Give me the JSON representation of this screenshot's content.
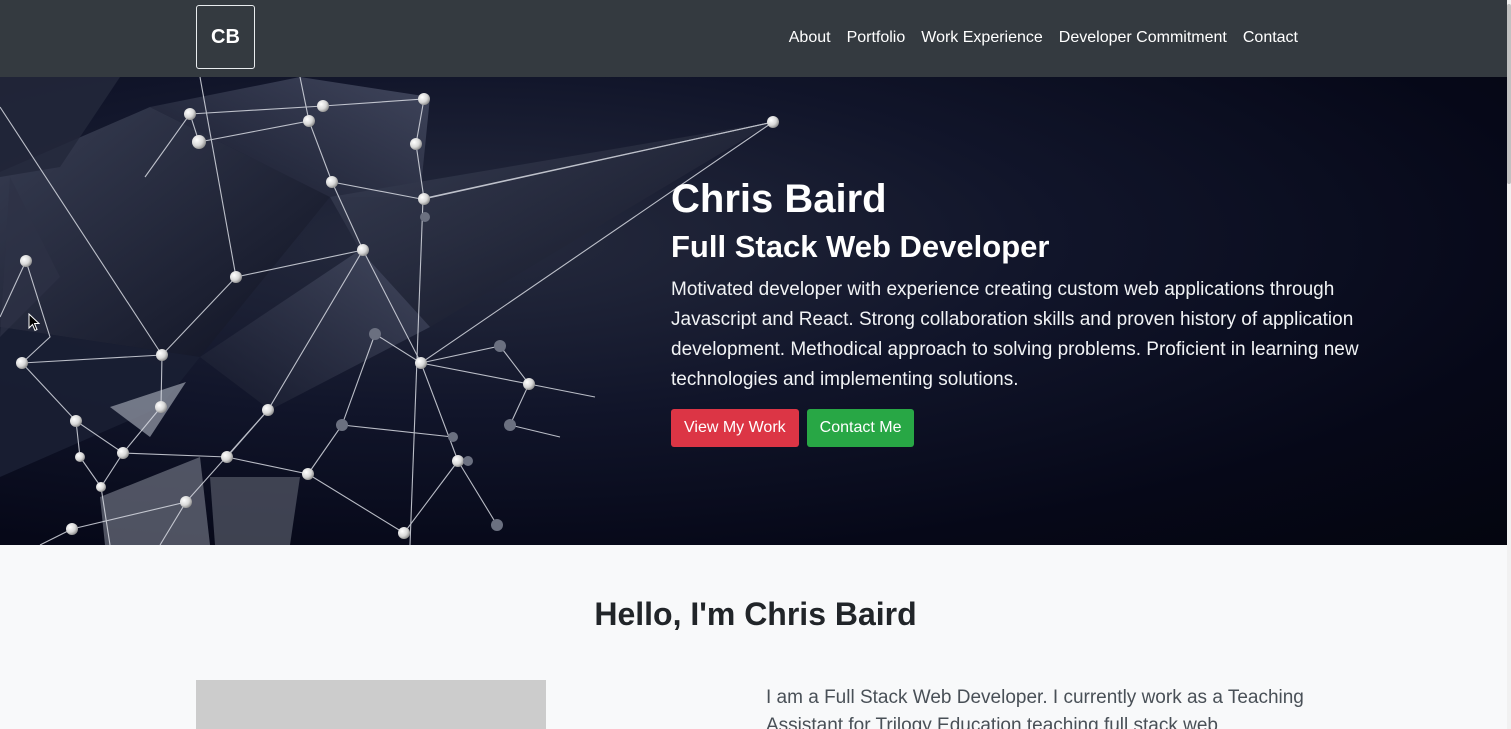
{
  "navbar": {
    "brand": "CB",
    "links": [
      "About",
      "Portfolio",
      "Work Experience",
      "Developer Commitment",
      "Contact"
    ]
  },
  "hero": {
    "name": "Chris Baird",
    "role": "Full Stack Web Developer",
    "description": "Motivated developer with experience creating custom web applications through Javascript and React. Strong collaboration skills and proven history of application development. Methodical approach to solving problems. Proficient in learning new technologies and implementing solutions.",
    "primary_button": "View My Work",
    "secondary_button": "Contact Me",
    "background_image": "network-polygon-graphic"
  },
  "about": {
    "title": "Hello, I'm Chris Baird",
    "text": "I am a Full Stack Web Developer. I currently work as a Teaching Assistant for Trilogy Education teaching full stack web"
  },
  "colors": {
    "navbar": "#343a40",
    "primary_button": "#dc3545",
    "secondary_button": "#28a745",
    "page_background": "#f8f9fa"
  }
}
